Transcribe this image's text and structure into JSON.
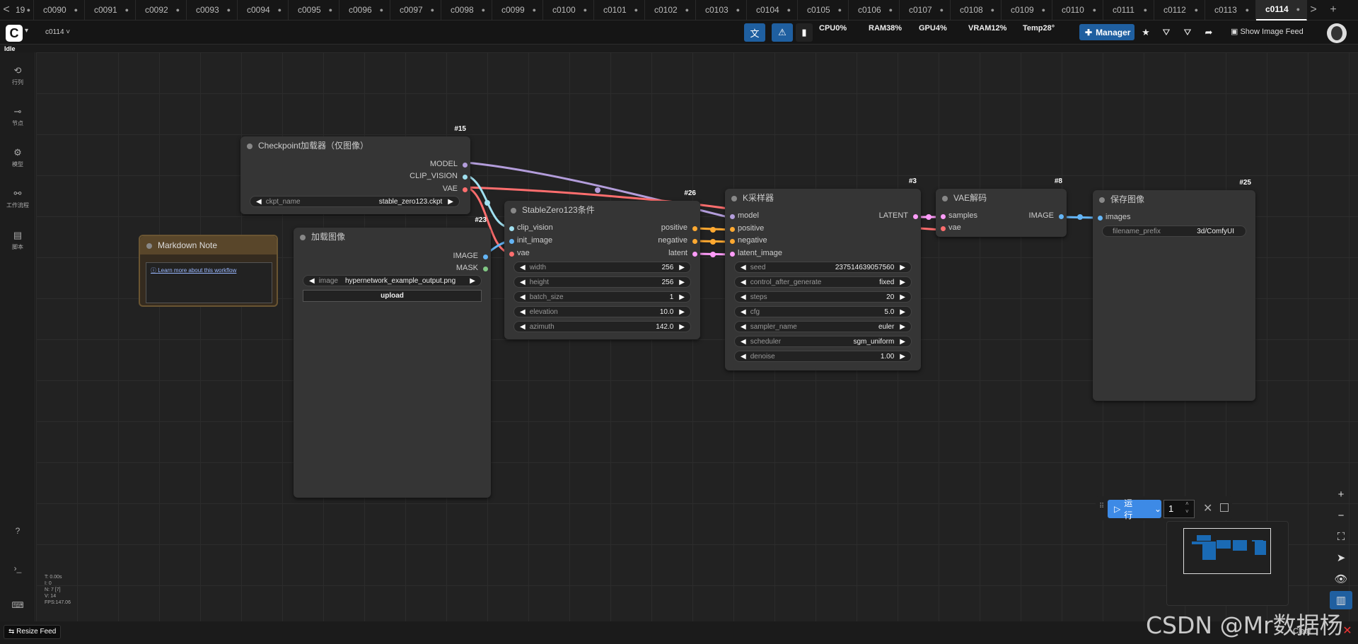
{
  "tabs": {
    "scroll_left": "<",
    "scroll_right": ">",
    "new_tab": "+",
    "first_partial": "19",
    "items": [
      "c0090",
      "c0091",
      "c0092",
      "c0093",
      "c0094",
      "c0095",
      "c0096",
      "c0097",
      "c0098",
      "c0099",
      "c0100",
      "c0101",
      "c0102",
      "c0103",
      "c0104",
      "c0105",
      "c0106",
      "c0107",
      "c0108",
      "c0109",
      "c0110",
      "c0111",
      "c0112",
      "c0113",
      "c0114"
    ],
    "active": "c0114",
    "dot": "●"
  },
  "menubar": {
    "logo": "C",
    "workflow_name": "c0114 ˅",
    "stats": {
      "cpu": "CPU0%",
      "ram": "RAM38%",
      "gpu": "GPU4%",
      "vram": "VRAM12%",
      "temp": "Temp28°"
    },
    "manager_label": "Manager",
    "show_image_feed": "Show Image Feed"
  },
  "status": "Idle",
  "sidebar": [
    {
      "label": "行列",
      "icon": "history-icon"
    },
    {
      "label": "节点",
      "icon": "node-icon"
    },
    {
      "label": "模型",
      "icon": "model-icon"
    },
    {
      "label": "工作流程",
      "icon": "workflow-icon"
    },
    {
      "label": "脚本",
      "icon": "script-icon"
    }
  ],
  "nodes": {
    "checkpoint": {
      "id": "#15",
      "title": "Checkpoint加载器（仅图像）",
      "outputs": [
        "MODEL",
        "CLIP_VISION",
        "VAE"
      ],
      "widget_label": "ckpt_name",
      "widget_value": "stable_zero123.ckpt"
    },
    "markdown": {
      "title": "Markdown Note",
      "link": "Learn more about this workflow"
    },
    "loadimage": {
      "id": "#23",
      "title": "加载图像",
      "outputs": [
        "IMAGE",
        "MASK"
      ],
      "widget_label": "image",
      "widget_value": "hypernetwork_example_output.png",
      "upload": "upload"
    },
    "zero123": {
      "id": "#26",
      "title": "StableZero123条件",
      "inputs": [
        "clip_vision",
        "init_image",
        "vae"
      ],
      "outputs": [
        "positive",
        "negative",
        "latent"
      ],
      "widgets": [
        {
          "label": "width",
          "value": "256"
        },
        {
          "label": "height",
          "value": "256"
        },
        {
          "label": "batch_size",
          "value": "1"
        },
        {
          "label": "elevation",
          "value": "10.0"
        },
        {
          "label": "azimuth",
          "value": "142.0"
        }
      ]
    },
    "ksampler": {
      "id": "#3",
      "title": "K采样器",
      "inputs": [
        "model",
        "positive",
        "negative",
        "latent_image"
      ],
      "output": "LATENT",
      "widgets": [
        {
          "label": "seed",
          "value": "237514639057560"
        },
        {
          "label": "control_after_generate",
          "value": "fixed"
        },
        {
          "label": "steps",
          "value": "20"
        },
        {
          "label": "cfg",
          "value": "5.0"
        },
        {
          "label": "sampler_name",
          "value": "euler"
        },
        {
          "label": "scheduler",
          "value": "sgm_uniform"
        },
        {
          "label": "denoise",
          "value": "1.00"
        }
      ]
    },
    "vaedecode": {
      "id": "#8",
      "title": "VAE解码",
      "inputs": [
        "samples",
        "vae"
      ],
      "output": "IMAGE"
    },
    "saveimage": {
      "id": "#25",
      "title": "保存图像",
      "input": "images",
      "widget_label": "filename_prefix",
      "widget_value": "3d/ComfyUI"
    }
  },
  "run": {
    "label": "运行",
    "count": "1"
  },
  "canvas_stats": [
    "T: 0.00s",
    "I: 0",
    "N: 7 [7]",
    "V: 14",
    "FPS:147.06"
  ],
  "bottom": {
    "resize_feed": "Resize Feed",
    "clear": "Clear",
    "watermark": "CSDN @Mr数据杨"
  },
  "colors": {
    "accent": "#3d8ae6",
    "model": "#b39ddb",
    "clip": "#a0e0f0",
    "vae": "#ff6e6e",
    "cond": "#ffa931",
    "latent": "#ff9cf9",
    "image": "#64b5f6",
    "mask": "#81c784"
  }
}
